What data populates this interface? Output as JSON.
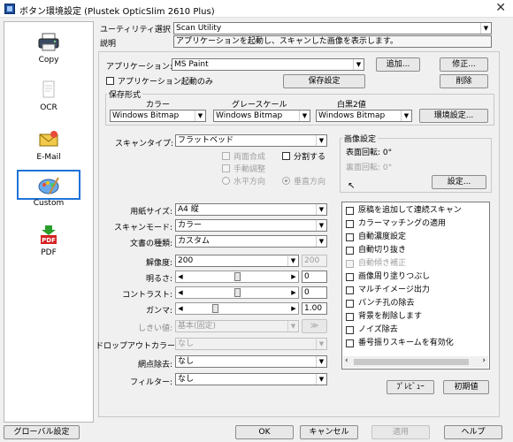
{
  "window": {
    "title": "ボタン環境設定 (Plustek OpticSlim 2610 Plus)"
  },
  "sidebar": {
    "items": [
      {
        "label": "Copy",
        "icon": "printer-icon"
      },
      {
        "label": "OCR",
        "icon": "document-icon"
      },
      {
        "label": "E-Mail",
        "icon": "envelope-icon"
      },
      {
        "label": "Custom",
        "icon": "paint-palette-icon",
        "selected": true
      },
      {
        "label": "PDF",
        "icon": "pdf-icon"
      }
    ]
  },
  "utility": {
    "label": "ユーティリティ選択",
    "value": "Scan Utility"
  },
  "description": {
    "label": "説明",
    "value": "アプリケーションを起動し、スキャンした画像を表示します。"
  },
  "application": {
    "label": "アプリケーション:",
    "value": "MS Paint",
    "add_button": "追加...",
    "edit_button": "修正...",
    "delete_button": "削除",
    "launch_only_label": "アプリケーション起動のみ",
    "save_settings_button": "保存設定"
  },
  "save_format": {
    "group_label": "保存形式",
    "color_label": "カラー",
    "gray_label": "グレースケール",
    "bw_label": "白黒2値",
    "color_value": "Windows Bitmap",
    "gray_value": "Windows Bitmap",
    "bw_value": "Windows Bitmap",
    "env_button": "環境設定..."
  },
  "scan": {
    "type_label": "スキャンタイプ:",
    "type_value": "フラットベッド",
    "duplex_label": "両面合成",
    "split_label": "分割する",
    "manual_adjust_label": "手動調整",
    "horizontal_label": "水平方向",
    "vertical_label": "垂直方向"
  },
  "image_settings": {
    "group_label": "画像設定",
    "front_rotation": "表面回転: 0°",
    "back_rotation": "裏面回転: 0°",
    "settings_button": "設定..."
  },
  "fields": {
    "paper_size_label": "用紙サイズ:",
    "paper_size_value": "A4 縦",
    "scan_mode_label": "スキャンモード:",
    "scan_mode_value": "カラー",
    "doc_type_label": "文書の種類:",
    "doc_type_value": "カスタム",
    "resolution_label": "解像度:",
    "resolution_value": "200",
    "resolution_extra": "200",
    "brightness_label": "明るさ:",
    "brightness_value": "0",
    "contrast_label": "コントラスト:",
    "contrast_value": "0",
    "gamma_label": "ガンマ:",
    "gamma_value": "1.00",
    "threshold_label": "しきい値:",
    "threshold_value": "基本(固定)",
    "dropout_label": "ドロップアウトカラー:",
    "dropout_value": "なし",
    "descreen_label": "網点除去:",
    "descreen_value": "なし",
    "filter_label": "フィルター:",
    "filter_value": "なし"
  },
  "sliders": {
    "brightness_level": 0.5,
    "contrast_level": 0.5,
    "gamma_level": 0.28
  },
  "options": [
    {
      "label": "原稿を追加して連続スキャン",
      "enabled": true
    },
    {
      "label": "カラーマッチングの適用",
      "enabled": true
    },
    {
      "label": "自動濃度設定",
      "enabled": true
    },
    {
      "label": "自動切り抜き",
      "enabled": true
    },
    {
      "label": "自動傾き補正",
      "enabled": false
    },
    {
      "label": "画像周り塗りつぶし",
      "enabled": true
    },
    {
      "label": "マルチイメージ出力",
      "enabled": true
    },
    {
      "label": "パンチ孔の除去",
      "enabled": true
    },
    {
      "label": "背景を削除します",
      "enabled": true
    },
    {
      "label": "ノイズ除去",
      "enabled": true
    },
    {
      "label": "番号振りスキームを有効化",
      "enabled": true
    }
  ],
  "buttons": {
    "preview": "ﾌﾟﾚﾋﾞｭｰ",
    "default": "初期値",
    "global": "グローバル設定",
    "ok": "OK",
    "cancel": "キャンセル",
    "apply": "適用",
    "help": "ヘルプ"
  },
  "colors": {
    "selection_border": "#1e73d8",
    "pdf_red": "#d42020",
    "pdf_green": "#2a9d2a"
  }
}
